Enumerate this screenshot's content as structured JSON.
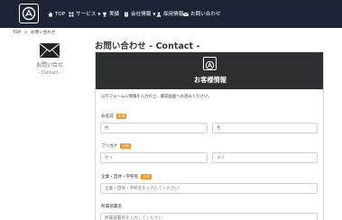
{
  "nav": {
    "logo_icon": "brand-logo-icon",
    "items": [
      {
        "label": "TOP",
        "icon": "home-icon"
      },
      {
        "label": "サービス",
        "icon": "grid-icon",
        "has_dropdown": true
      },
      {
        "label": "実績",
        "icon": "trophy-icon"
      },
      {
        "label": "会社情報",
        "icon": "building-icon",
        "has_dropdown": true
      },
      {
        "label": "採用情報",
        "icon": "person-icon"
      },
      {
        "label": "お問い合わせ",
        "icon": "envelope-icon"
      }
    ]
  },
  "breadcrumb": {
    "home": "TOP",
    "separator": ">",
    "current": "お問い合わせ"
  },
  "sidebar": {
    "title": "お問い合せ",
    "subtitle": "- Contact -",
    "icon": "envelope-icon"
  },
  "page_title": "お問い合わせ - Contact -",
  "form": {
    "header_title": "お客様情報",
    "intro": "以下フォームに情報を入力の上、確認画面へお進みください。",
    "required_label": "必須",
    "fields": {
      "name": {
        "label": "お名前",
        "required": true,
        "first_placeholder": "姓",
        "last_placeholder": "名"
      },
      "kana": {
        "label": "フリガナ",
        "required": true,
        "first_placeholder": "セイ",
        "last_placeholder": "メイ"
      },
      "company": {
        "label": "企業・団体・学校名",
        "required": true,
        "placeholder": "企業・団体・学校名を入力してください"
      },
      "department": {
        "label": "所属部署名",
        "required": false,
        "placeholder": "所属部署名を入力してください"
      }
    }
  },
  "colors": {
    "header_bg": "#1e2435",
    "panel_header_bg": "#2e2f30",
    "required_badge": "#f0921d"
  }
}
